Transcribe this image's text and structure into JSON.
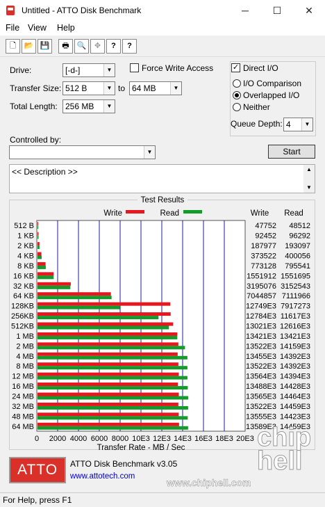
{
  "window": {
    "title": "Untitled - ATTO Disk Benchmark",
    "minimize": "─",
    "maximize": "☐",
    "close": "✕"
  },
  "menu": [
    "File",
    "View",
    "Help"
  ],
  "toolbar": {
    "new": "🗋",
    "open": "📂",
    "save": "💾",
    "print": "🖶",
    "preview": "🔍",
    "move": "✥",
    "about": "?",
    "context_help": "?"
  },
  "settings": {
    "drive_label": "Drive:",
    "drive_value": "[-d-]",
    "force_write_label": "Force Write Access",
    "force_write_checked": false,
    "direct_io_label": "Direct I/O",
    "direct_io_checked": true,
    "transfer_size_label": "Transfer Size:",
    "transfer_from": "512 B",
    "to_label": "to",
    "transfer_to": "64 MB",
    "total_length_label": "Total Length:",
    "total_length": "256 MB",
    "io_comparison_label": "I/O Comparison",
    "overlapped_io_label": "Overlapped I/O",
    "neither_label": "Neither",
    "selected_mode": "Overlapped I/O",
    "queue_depth_label": "Queue Depth:",
    "queue_depth": "4",
    "controlled_by_label": "Controlled by:",
    "controlled_by_value": "",
    "start_label": "Start",
    "description": "<< Description >>"
  },
  "results": {
    "title": "Test Results",
    "write_label": "Write",
    "read_label": "Read",
    "write_col": "Write",
    "read_col": "Read",
    "write_color": "#e8161e",
    "read_color": "#159b2c"
  },
  "chart_data": {
    "type": "bar",
    "orientation": "horizontal",
    "categories": [
      "512 B",
      "1 KB",
      "2 KB",
      "4 KB",
      "8 KB",
      "16 KB",
      "32 KB",
      "64 KB",
      "128KB",
      "256KB",
      "512KB",
      "1 MB",
      "2 MB",
      "4 MB",
      "8 MB",
      "12 MB",
      "16 MB",
      "24 MB",
      "32 MB",
      "48 MB",
      "64 MB"
    ],
    "series": [
      {
        "name": "Write",
        "values": [
          47752,
          92452,
          187977,
          373522,
          773128,
          1551912,
          3195076,
          7044857,
          12749000,
          12784000,
          13021000,
          13421000,
          13522000,
          13455000,
          13522000,
          13564000,
          13488000,
          13565000,
          13522000,
          13555000,
          13589000
        ],
        "labels": [
          "47752",
          "92452",
          "187977",
          "373522",
          "773128",
          "1551912",
          "3195076",
          "7044857",
          "12749E3",
          "12784E3",
          "13021E3",
          "13421E3",
          "13522E3",
          "13455E3",
          "13522E3",
          "13564E3",
          "13488E3",
          "13565E3",
          "13522E3",
          "13555E3",
          "13589E3"
        ]
      },
      {
        "name": "Read",
        "values": [
          48512,
          96292,
          193097,
          400056,
          795541,
          1551695,
          3152543,
          7111966,
          7917273,
          11617000,
          12616000,
          13421000,
          14159000,
          14392000,
          14392000,
          14394000,
          14428000,
          14464000,
          14459000,
          14423000,
          14459000
        ],
        "labels": [
          "48512",
          "96292",
          "193097",
          "400056",
          "795541",
          "1551695",
          "3152543",
          "7111966",
          "7917273",
          "11617E3",
          "12616E3",
          "13421E3",
          "14159E3",
          "14392E3",
          "14392E3",
          "14394E3",
          "14428E3",
          "14464E3",
          "14459E3",
          "14423E3",
          "14459E3"
        ]
      }
    ],
    "xlim": [
      0,
      20000000
    ],
    "x_ticks": [
      "0",
      "2000",
      "4000",
      "6000",
      "8000",
      "10E3",
      "12E3",
      "14E3",
      "16E3",
      "18E3",
      "20E3"
    ],
    "xlabel": "Transfer Rate - MB / Sec"
  },
  "footer": {
    "logo_text": "ATTO",
    "product": "ATTO Disk Benchmark v3.05",
    "url": "www.attotech.com",
    "watermark": "www.chiphell.com",
    "watermark_logo": "chip hell"
  },
  "status": "For Help, press F1"
}
